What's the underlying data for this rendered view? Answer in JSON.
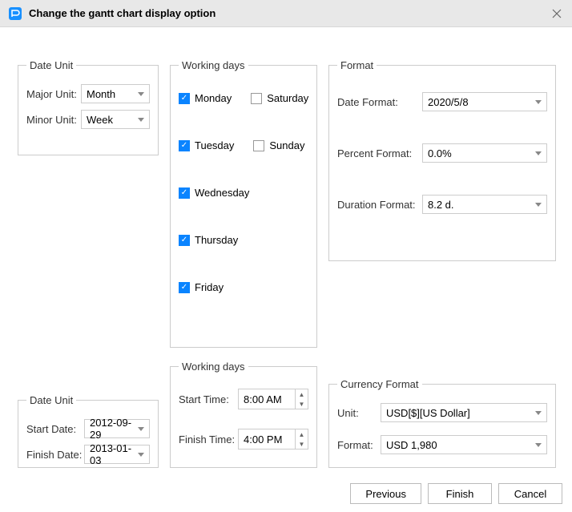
{
  "title": "Change the gantt chart display option",
  "dateUnit": {
    "legend": "Date Unit",
    "majorLabel": "Major Unit:",
    "majorValue": "Month",
    "minorLabel": "Minor Unit:",
    "minorValue": "Week"
  },
  "workingDays1": {
    "legend": "Working days",
    "days": [
      {
        "label": "Monday",
        "checked": true
      },
      {
        "label": "Tuesday",
        "checked": true
      },
      {
        "label": "Wednesday",
        "checked": true
      },
      {
        "label": "Thursday",
        "checked": true
      },
      {
        "label": "Friday",
        "checked": true
      },
      {
        "label": "Saturday",
        "checked": false
      },
      {
        "label": "Sunday",
        "checked": false
      }
    ]
  },
  "format": {
    "legend": "Format",
    "dateFormatLabel": "Date Format:",
    "dateFormatValue": "2020/5/8",
    "percentFormatLabel": "Percent Format:",
    "percentFormatValue": "0.0%",
    "durationFormatLabel": "Duration Format:",
    "durationFormatValue": "8.2 d."
  },
  "dateUnit2": {
    "legend": "Date Unit",
    "startDateLabel": "Start Date:",
    "startDateValue": "2012-09-29",
    "finishDateLabel": "Finish Date:",
    "finishDateValue": "2013-01-03"
  },
  "workingDays2": {
    "legend": "Working days",
    "startTimeLabel": "Start Time:",
    "startTimeValue": "8:00 AM",
    "finishTimeLabel": "Finish Time:",
    "finishTimeValue": "4:00 PM"
  },
  "currencyFormat": {
    "legend": "Currency Format",
    "unitLabel": "Unit:",
    "unitValue": "USD[$][US Dollar]",
    "formatLabel": "Format:",
    "formatValue": "USD 1,980"
  },
  "buttons": {
    "previous": "Previous",
    "finish": "Finish",
    "cancel": "Cancel"
  }
}
